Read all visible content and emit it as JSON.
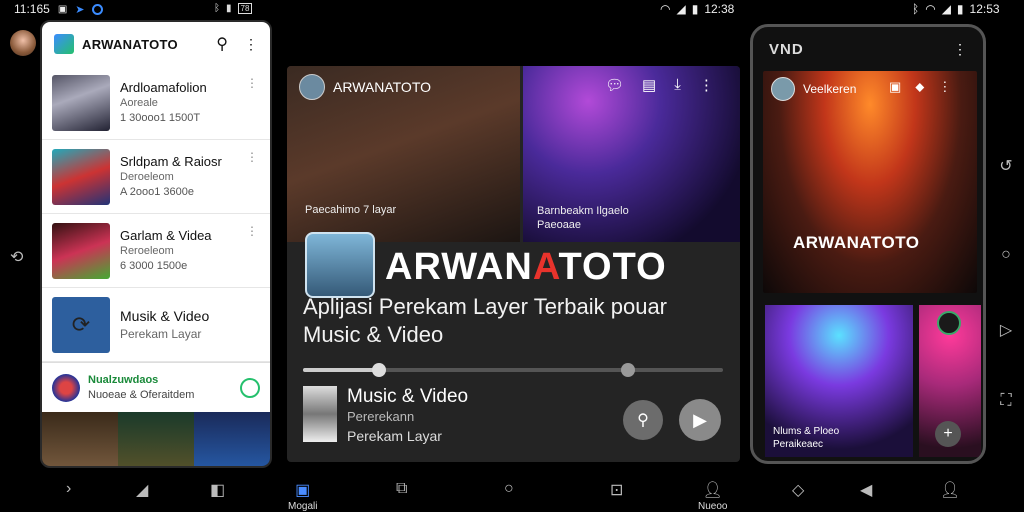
{
  "status": {
    "left_time": "11:165",
    "left_battery": "78",
    "mid_time": "12:38",
    "right_time": "12:53"
  },
  "left_phone": {
    "app_title": "ARWANATOTO",
    "items": [
      {
        "title": "Ardloamafolion",
        "subtitle": "Aoreale",
        "meta": "1 30ooo1  1500T"
      },
      {
        "title": "Srldpam & Raiosr",
        "subtitle": "Deroeleom",
        "meta": "A 2ooo1  3600e"
      },
      {
        "title": "Garlam & Videa",
        "subtitle": "Reroeleom",
        "meta": "6 3000  1500e"
      },
      {
        "title": "Musik & Video",
        "subtitle": "Perekam Layar",
        "meta": ""
      }
    ],
    "promo": {
      "title": "Nualzuwdaos",
      "subtitle": "Nuoeae & Oferaitdem"
    }
  },
  "center": {
    "header_title": "ARWANATOTO",
    "caption_left": "Paecahimo 7 layar",
    "caption_right": "Barnbeakm Ilgaelo\nPaeoaae",
    "brand_pre": "ARWAN",
    "brand_accent": "A",
    "brand_post": "TOTO",
    "tagline_line1": "Aplijasi Perekam Layer Terbaik pouar",
    "tagline_line2": "Music & Video",
    "progress": 0.18,
    "track_title": "Music & Video",
    "track_line2": "Pererekann",
    "track_line3": "Perekam Layar"
  },
  "right_phone": {
    "logo": "VND",
    "hero_title": "Veelkeren",
    "brand": "ARWANATOTO",
    "tile_caption": "Nlums & Ploeo\nPeraikeaec"
  },
  "bottom_nav": {
    "active_label": "Mogali",
    "profile_label": "Nueoo"
  },
  "colors": {
    "brand_accent": "#e8332c",
    "active_nav": "#4a8cff",
    "promo_green": "#1a8a3a"
  }
}
